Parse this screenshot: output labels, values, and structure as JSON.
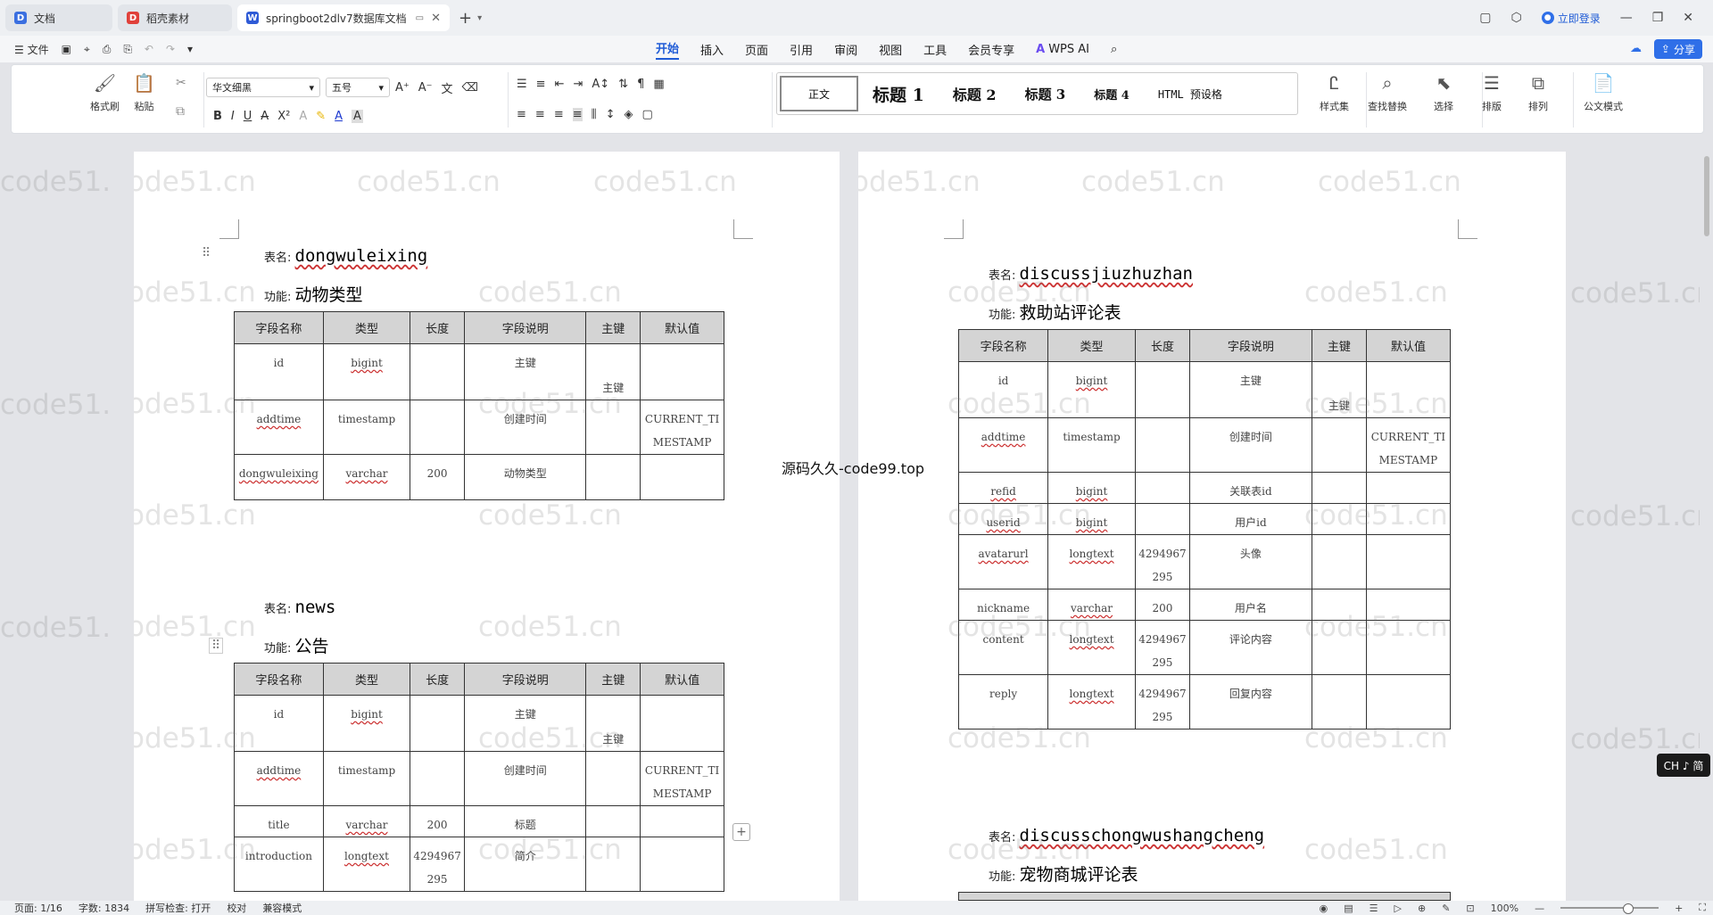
{
  "tabs": [
    {
      "label": "文档",
      "icon": "document-icon",
      "color": "#3b6fe0"
    },
    {
      "label": "稻壳素材",
      "icon": "docer-icon",
      "color": "#e0403a"
    },
    {
      "label": "springboot2dlv7数据库文档",
      "icon": "word-icon",
      "color": "#2f5bd6"
    }
  ],
  "window": {
    "login": "立即登录"
  },
  "menubar": {
    "file": "文件",
    "tabs": [
      "开始",
      "插入",
      "页面",
      "引用",
      "审阅",
      "视图",
      "工具",
      "会员专享"
    ],
    "wps_ai": "WPS AI",
    "share": "分享"
  },
  "ribbon": {
    "format_painter": "格式刷",
    "paste": "粘贴",
    "font": "华文细黑",
    "size": "五号",
    "styles": [
      "正文",
      "标题 1",
      "标题 2",
      "标题 3",
      "标题 4",
      "HTML 预设格"
    ],
    "style_set": "样式集",
    "find_replace": "查找替换",
    "select": "选择",
    "layout": "排版",
    "arrange": "排列",
    "official": "公文模式"
  },
  "doc": {
    "table_label": "表名:",
    "func_label": "功能:",
    "headers": [
      "字段名称",
      "类型",
      "长度",
      "字段说明",
      "主键",
      "默认值"
    ],
    "page1": {
      "t1": {
        "name": "dongwuleixing",
        "func": "动物类型",
        "rows": [
          {
            "name": "id",
            "type": "bigint",
            "len": "",
            "desc": "主键",
            "pk": "主键",
            "def": ""
          },
          {
            "name": "addtime",
            "type": "timestamp",
            "len": "",
            "desc": "创建时间",
            "pk": "",
            "def": "CURRENT_TIMESTAMP"
          },
          {
            "name": "dongwuleixing",
            "type": "varchar",
            "len": "200",
            "desc": "动物类型",
            "pk": "",
            "def": ""
          }
        ]
      },
      "t2": {
        "name": "news",
        "func": "公告",
        "rows": [
          {
            "name": "id",
            "type": "bigint",
            "len": "",
            "desc": "主键",
            "pk": "主键",
            "def": ""
          },
          {
            "name": "addtime",
            "type": "timestamp",
            "len": "",
            "desc": "创建时间",
            "pk": "",
            "def": "CURRENT_TIMESTAMP"
          },
          {
            "name": "title",
            "type": "varchar",
            "len": "200",
            "desc": "标题",
            "pk": "",
            "def": ""
          },
          {
            "name": "introduction",
            "type": "longtext",
            "len": "4294967295",
            "desc": "简介",
            "pk": "",
            "def": ""
          }
        ]
      }
    },
    "page2": {
      "t1": {
        "name": "discussjiuzhuzhan",
        "func": "救助站评论表",
        "rows": [
          {
            "name": "id",
            "type": "bigint",
            "len": "",
            "desc": "主键",
            "pk": "主键",
            "def": ""
          },
          {
            "name": "addtime",
            "type": "timestamp",
            "len": "",
            "desc": "创建时间",
            "pk": "",
            "def": "CURRENT_TIMESTAMP"
          },
          {
            "name": "refid",
            "type": "bigint",
            "len": "",
            "desc": "关联表id",
            "pk": "",
            "def": ""
          },
          {
            "name": "userid",
            "type": "bigint",
            "len": "",
            "desc": "用户id",
            "pk": "",
            "def": ""
          },
          {
            "name": "avatarurl",
            "type": "longtext",
            "len": "4294967295",
            "desc": "头像",
            "pk": "",
            "def": ""
          },
          {
            "name": "nickname",
            "type": "varchar",
            "len": "200",
            "desc": "用户名",
            "pk": "",
            "def": ""
          },
          {
            "name": "content",
            "type": "longtext",
            "len": "4294967295",
            "desc": "评论内容",
            "pk": "",
            "def": ""
          },
          {
            "name": "reply",
            "type": "longtext",
            "len": "4294967295",
            "desc": "回复内容",
            "pk": "",
            "def": ""
          }
        ]
      },
      "t2": {
        "name": "discusschongwushangcheng",
        "func": "宠物商城评论表"
      }
    },
    "watermark": "code51.cn",
    "overlay": "源码久久-code99.top"
  },
  "ime": "CH ♪ 简",
  "status": {
    "page": "页面: 1/16",
    "words": "字数: 1834",
    "spell": "拼写检查: 打开",
    "proof": "校对",
    "compat": "兼容模式",
    "zoom": "100%"
  }
}
